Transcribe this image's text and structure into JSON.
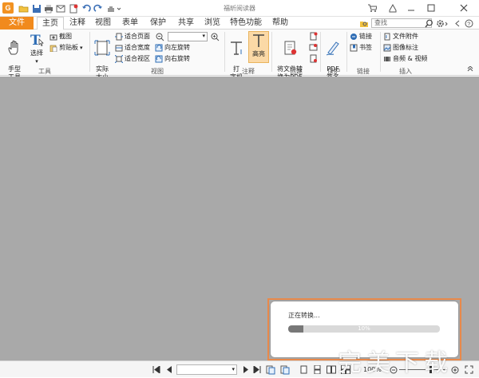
{
  "app": {
    "title": "福昕阅读器",
    "logo_letter": "G"
  },
  "tabs": [
    {
      "label": "文件"
    },
    {
      "label": "主页"
    },
    {
      "label": "注释"
    },
    {
      "label": "视图"
    },
    {
      "label": "表单"
    },
    {
      "label": "保护"
    },
    {
      "label": "共享"
    },
    {
      "label": "浏览"
    },
    {
      "label": "特色功能"
    },
    {
      "label": "帮助"
    }
  ],
  "search": {
    "placeholder": "查找"
  },
  "ribbon": {
    "tools": {
      "hand": "手型\n工具",
      "select": "选择",
      "snapshot": "截图",
      "clipboard": "剪贴板",
      "group": "工具"
    },
    "view": {
      "actual_size": "实际\n大小",
      "fit_page": "适合页面",
      "fit_width": "适合宽度",
      "fit_visible": "适合视区",
      "rotate_left": "向左旋转",
      "rotate_right": "向右旋转",
      "group": "视图"
    },
    "comment": {
      "typewriter": "打\n字机",
      "highlight": "高亮",
      "group": "注释"
    },
    "create": {
      "convert": "将文件转\n换为PDF",
      "group": "创建"
    },
    "protect": {
      "sign": "PDF\n签名",
      "group": "保护"
    },
    "links": {
      "link": "链接",
      "bookmark": "书签",
      "group": "链接"
    },
    "insert": {
      "attachment": "文件附件",
      "image": "图像标注",
      "av": "音频 & 视频",
      "group": "插入"
    }
  },
  "dialog": {
    "message": "正在转换...",
    "progress_text": "10%",
    "progress": 0.1
  },
  "status": {
    "zoom": "100%"
  },
  "watermark": "完美下载",
  "colors": {
    "accent": "#f18a1d",
    "workspace": "#a9a9a9",
    "dialog_border": "#e9894a"
  }
}
